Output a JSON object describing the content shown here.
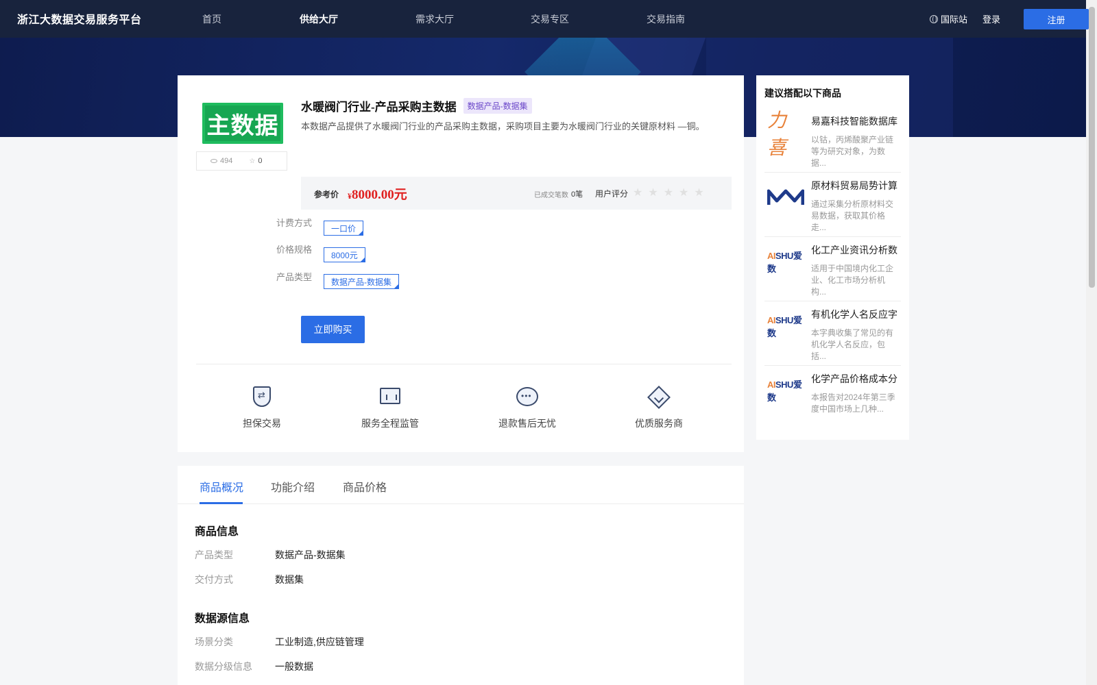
{
  "header": {
    "brand": "浙江大数据交易服务平台",
    "nav": [
      "首页",
      "供给大厅",
      "需求大厅",
      "交易专区",
      "交易指南"
    ],
    "intl": "国际站",
    "login": "登录",
    "register": "注册"
  },
  "product": {
    "logo_text": "主数据",
    "views": "494",
    "favorites": "0",
    "title": "水暖阀门行业-产品采购主数据",
    "tag": "数据产品-数据集",
    "description": "本数据产品提供了水暖阀门行业的产品采购主数据，采购项目主要为水暖阀门行业的关键原材料 —铜。",
    "ref_price_label": "参考价",
    "currency": "¥",
    "price": "8000.00元",
    "deals_label": "已成交笔数",
    "deals_value": "0笔",
    "rating_label": "用户评分",
    "rating_stars": 0,
    "specs": [
      {
        "label": "计费方式",
        "value": "一口价"
      },
      {
        "label": "价格规格",
        "value": "8000元"
      },
      {
        "label": "产品类型",
        "value": "数据产品-数据集"
      }
    ],
    "buy_button": "立即购买",
    "features": [
      {
        "label": "担保交易",
        "icon": "shield-exchange-icon"
      },
      {
        "label": "服务全程监管",
        "icon": "monitor-chart-icon"
      },
      {
        "label": "退款售后无忧",
        "icon": "chat-bubble-icon"
      },
      {
        "label": "优质服务商",
        "icon": "diamond-icon"
      }
    ]
  },
  "sidebar": {
    "title": "建议搭配以下商品",
    "items": [
      {
        "name": "易嘉科技智能数据库",
        "desc": "以钴，丙烯酸聚产业链等为研究对象，为数据...",
        "logo": "yijia-logo"
      },
      {
        "name": "原材料贸易局势计算",
        "desc": "通过采集分析原材料交易数据，获取其价格走...",
        "logo": "molecule-logo"
      },
      {
        "name": "化工产业资讯分析数",
        "desc": "适用于中国境内化工企业、化工市场分析机构...",
        "logo": "aishu-logo"
      },
      {
        "name": "有机化学人名反应字",
        "desc": "本字典收集了常见的有机化学人名反应，包括...",
        "logo": "aishu-logo"
      },
      {
        "name": "化学产品价格成本分",
        "desc": "本报告对2024年第三季度中国市场上几种...",
        "logo": "aishu-logo"
      }
    ],
    "logo_text_yijia": "力喜",
    "logo_text_aishu": "SHU爱数",
    "logo_text_aishu_a": "AI"
  },
  "tabs": [
    "商品概况",
    "功能介绍",
    "商品价格"
  ],
  "overview": {
    "section1_title": "商品信息",
    "section1": [
      {
        "label": "产品类型",
        "value": "数据产品-数据集"
      },
      {
        "label": "交付方式",
        "value": "数据集"
      }
    ],
    "section2_title": "数据源信息",
    "section2": [
      {
        "label": "场景分类",
        "value": "工业制造,供应链管理"
      },
      {
        "label": "数据分级信息",
        "value": "一般数据"
      }
    ]
  }
}
